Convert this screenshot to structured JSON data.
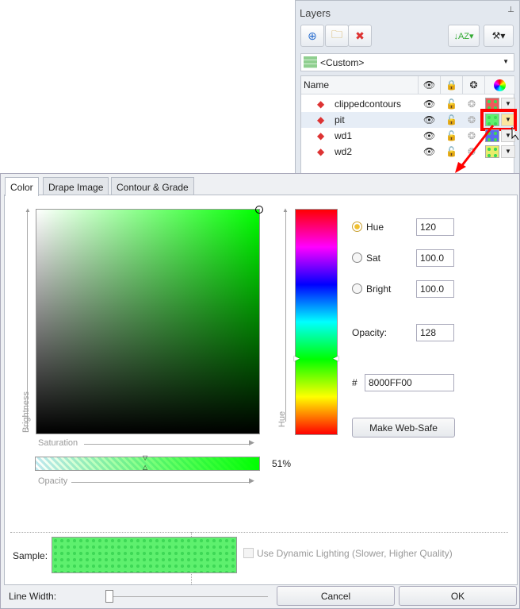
{
  "layers": {
    "title": "Layers",
    "preset": "<Custom>",
    "column_name": "Name",
    "rows": [
      {
        "name": "clippedcontours",
        "color": "#ee5a5a"
      },
      {
        "name": "pit",
        "color": "#4ade5a"
      },
      {
        "name": "wd1",
        "color": "#5a6af0"
      },
      {
        "name": "wd2",
        "color": "#e8ec6a"
      }
    ]
  },
  "tabs": [
    "Color",
    "Drape Image",
    "Contour & Grade"
  ],
  "picker": {
    "brightness_label": "Brightness",
    "saturation_label": "Saturation",
    "hue_axis_label": "Hue",
    "opacity_axis_label": "Opacity",
    "opacity_percent": "51%"
  },
  "fields": {
    "hue_label": "Hue",
    "hue": "120",
    "sat_label": "Sat",
    "sat": "100.0",
    "bright_label": "Bright",
    "bright": "100.0",
    "opacity_label": "Opacity:",
    "opacity": "128",
    "hash_label": "#",
    "hex": "8000FF00",
    "web_safe": "Make Web-Safe"
  },
  "sample": {
    "label": "Sample:",
    "lighting": "Use Dynamic Lighting (Slower, Higher Quality)"
  },
  "footer": {
    "line_width_label": "Line Width:",
    "cancel": "Cancel",
    "ok": "OK"
  },
  "colors": {
    "accent": "#00ff00",
    "highlight": "#ff0000"
  }
}
